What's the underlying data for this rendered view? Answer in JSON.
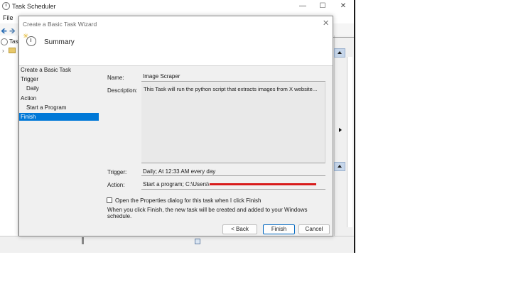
{
  "app": {
    "title": "Task Scheduler",
    "menu_file": "File",
    "tree_label": "Tasl"
  },
  "wizard": {
    "title": "Create a Basic Task Wizard",
    "header_title": "Summary",
    "steps": [
      {
        "label": "Create a Basic Task",
        "level": 1,
        "active": false
      },
      {
        "label": "Trigger",
        "level": 1,
        "active": false
      },
      {
        "label": "Daily",
        "level": 2,
        "active": false
      },
      {
        "label": "Action",
        "level": 1,
        "active": false
      },
      {
        "label": "Start a Program",
        "level": 2,
        "active": false
      },
      {
        "label": "Finish",
        "level": 1,
        "active": true
      }
    ],
    "fields": {
      "name_label": "Name:",
      "name_value": "Image Scraper",
      "description_label": "Description:",
      "description_value": "This Task will run the python script that extracts images from X website...",
      "trigger_label": "Trigger:",
      "trigger_value": "Daily; At 12:33 AM every day",
      "action_label": "Action:",
      "action_value": "Start a program; C:\\Users\\"
    },
    "checkbox_label": "Open the Properties dialog for this task when I click Finish",
    "checkbox_checked": false,
    "info_text": "When you click Finish, the new task will be created and added to your Windows schedule.",
    "buttons": {
      "back": "< Back",
      "finish": "Finish",
      "cancel": "Cancel"
    }
  },
  "colors": {
    "selection": "#0078d7",
    "redaction": "#d81b1b"
  }
}
